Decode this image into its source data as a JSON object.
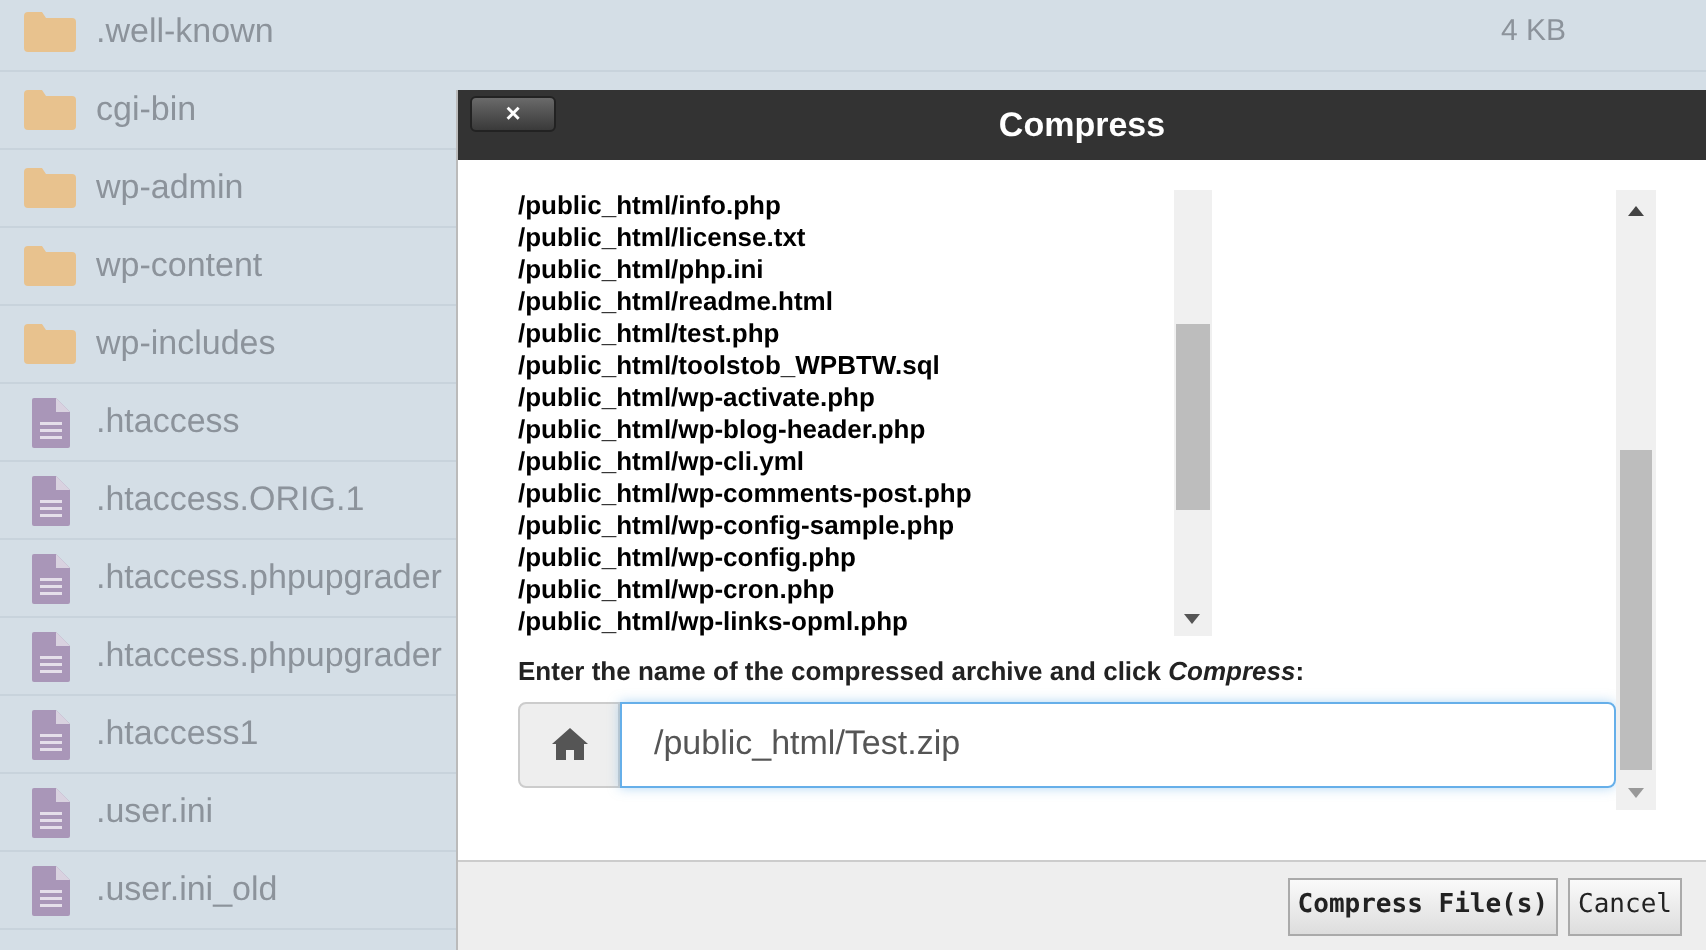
{
  "files": [
    {
      "kind": "folder",
      "name": ".well-known",
      "size": "4 KB"
    },
    {
      "kind": "folder",
      "name": "cgi-bin"
    },
    {
      "kind": "folder",
      "name": "wp-admin"
    },
    {
      "kind": "folder",
      "name": "wp-content"
    },
    {
      "kind": "folder",
      "name": "wp-includes"
    },
    {
      "kind": "file",
      "name": ".htaccess"
    },
    {
      "kind": "file",
      "name": ".htaccess.ORIG.1"
    },
    {
      "kind": "file",
      "name": ".htaccess.phpupgrader"
    },
    {
      "kind": "file",
      "name": ".htaccess.phpupgrader"
    },
    {
      "kind": "file",
      "name": ".htaccess1"
    },
    {
      "kind": "file",
      "name": ".user.ini"
    },
    {
      "kind": "file",
      "name": ".user.ini_old"
    }
  ],
  "dialog": {
    "title": "Compress",
    "close_label": "×",
    "selected_files": [
      "/public_html/info.php",
      "/public_html/license.txt",
      "/public_html/php.ini",
      "/public_html/readme.html",
      "/public_html/test.php",
      "/public_html/toolstob_WPBTW.sql",
      "/public_html/wp-activate.php",
      "/public_html/wp-blog-header.php",
      "/public_html/wp-cli.yml",
      "/public_html/wp-comments-post.php",
      "/public_html/wp-config-sample.php",
      "/public_html/wp-config.php",
      "/public_html/wp-cron.php",
      "/public_html/wp-links-opml.php"
    ],
    "prompt": "Enter the name of the compressed archive and click *Compress*:",
    "archive_name": "/public_html/Test.zip",
    "buttons": [
      {
        "kind": "primary",
        "label": "Compress File(s)"
      },
      {
        "kind": "secondary",
        "label": "Cancel"
      }
    ]
  }
}
